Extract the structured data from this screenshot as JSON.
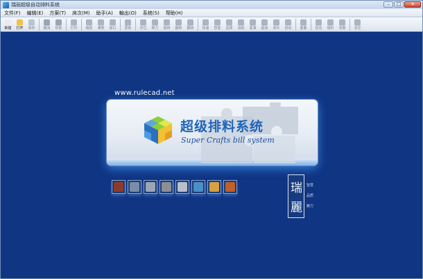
{
  "window": {
    "title": "瑞丽超级自动排料系统",
    "controls": {
      "minimize": "–",
      "maximize": "□",
      "close": "✕"
    }
  },
  "menu": [
    {
      "label": "文件(F)"
    },
    {
      "label": "编辑(E)"
    },
    {
      "label": "方案(T)"
    },
    {
      "label": "床次(M)"
    },
    {
      "label": "助手(A)"
    },
    {
      "label": "輸出(O)"
    },
    {
      "label": "系统(S)"
    },
    {
      "label": "帮助(H)"
    }
  ],
  "toolbar": [
    {
      "label": "新建",
      "icon": "new-file-icon",
      "active": true,
      "color": "#e8ecf2"
    },
    {
      "label": "打开",
      "icon": "open-folder-icon",
      "active": true,
      "color": "#f0c24a"
    },
    {
      "label": "保存",
      "icon": "save-icon",
      "active": false,
      "color": "#b8c4d4"
    },
    {
      "sep": true
    },
    {
      "label": "撤消",
      "icon": "undo-icon",
      "active": false,
      "color": "#9aa6b6"
    },
    {
      "label": "恢复",
      "icon": "redo-icon",
      "active": false,
      "color": "#9aa6b6"
    },
    {
      "sep": true
    },
    {
      "label": "打印",
      "icon": "print-icon",
      "active": false,
      "color": "#aab4c2"
    },
    {
      "sep": true
    },
    {
      "label": "缩放",
      "icon": "zoom-icon",
      "active": false,
      "color": "#aab4c2"
    },
    {
      "label": "满宽",
      "icon": "fit-width-icon",
      "active": false,
      "color": "#aab4c2"
    },
    {
      "label": "窗口",
      "icon": "window-icon",
      "active": false,
      "color": "#aab4c2"
    },
    {
      "sep": true
    },
    {
      "label": "更新",
      "icon": "refresh-icon",
      "active": false,
      "color": "#aab4c2"
    },
    {
      "sep": true
    },
    {
      "label": "定位",
      "icon": "pointer-icon",
      "active": false,
      "color": "#aab4c2"
    },
    {
      "label": "移力",
      "icon": "move-icon",
      "active": false,
      "color": "#aab4c2"
    },
    {
      "label": "旋转",
      "icon": "rotate-icon",
      "active": false,
      "color": "#aab4c2"
    },
    {
      "label": "翻转",
      "icon": "flip-icon",
      "active": false,
      "color": "#aab4c2"
    },
    {
      "label": "翻转",
      "icon": "flip-vertical-icon",
      "active": false,
      "color": "#aab4c2"
    },
    {
      "sep": true
    },
    {
      "label": "快速",
      "icon": "quick-icon",
      "active": false,
      "color": "#aab4c2"
    },
    {
      "label": "智能",
      "icon": "smart-icon",
      "active": false,
      "color": "#aab4c2"
    },
    {
      "label": "选择",
      "icon": "select-icon",
      "active": false,
      "color": "#aab4c2"
    },
    {
      "label": "消除",
      "icon": "clear-icon",
      "active": false,
      "color": "#aab4c2"
    },
    {
      "label": "紧凑",
      "icon": "compact-icon",
      "active": false,
      "color": "#aab4c2"
    },
    {
      "label": "超级",
      "icon": "super-icon",
      "active": false,
      "color": "#aab4c2"
    },
    {
      "label": "单片",
      "icon": "single-piece-icon",
      "active": false,
      "color": "#aab4c2"
    },
    {
      "label": "自动",
      "icon": "auto-icon",
      "active": false,
      "color": "#aab4c2"
    },
    {
      "sep": true
    },
    {
      "label": "重叠",
      "icon": "overlap-icon",
      "active": false,
      "color": "#aab4c2"
    },
    {
      "sep": true
    },
    {
      "label": "信息",
      "icon": "info-icon",
      "active": false,
      "color": "#aab4c2"
    },
    {
      "label": "缝料",
      "icon": "seam-icon",
      "active": false,
      "color": "#aab4c2"
    },
    {
      "label": "测量",
      "icon": "measure-icon",
      "active": false,
      "color": "#aab4c2"
    },
    {
      "sep": true
    },
    {
      "label": "清空",
      "icon": "clear-all-icon",
      "active": false,
      "color": "#aab4c2"
    }
  ],
  "splash": {
    "url": "www.rulecad.net",
    "title_cn": "超级排料系统",
    "title_en": "Super Crafts bill system"
  },
  "quick_icons": [
    {
      "icon": "marker-sheet-icon",
      "color": "#8e3a2a"
    },
    {
      "icon": "pattern-import-icon",
      "color": "#7a8ca8"
    },
    {
      "icon": "export-icon",
      "color": "#9aa6b8"
    },
    {
      "icon": "settings-gears-icon",
      "color": "#8d8f96"
    },
    {
      "icon": "table-icon",
      "color": "#b8c0cc"
    },
    {
      "icon": "picture-icon",
      "color": "#4a8fc8"
    },
    {
      "icon": "color-wheel-icon",
      "color": "#d8a040"
    },
    {
      "icon": "palette-icon",
      "color": "#c0602a"
    }
  ],
  "seal": {
    "chars": [
      "瑞",
      "麗"
    ],
    "mottos": [
      "智慧",
      "品质",
      "魅力"
    ]
  }
}
